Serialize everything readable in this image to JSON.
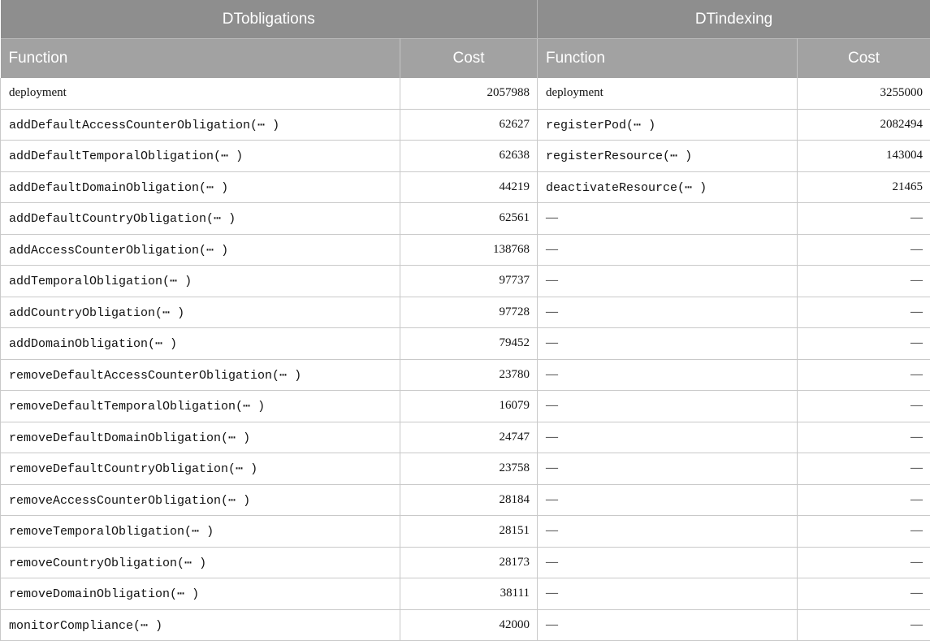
{
  "header": {
    "group_left": "DTobligations",
    "group_right": "DTindexing",
    "col_function_left": "Function",
    "col_cost_left": "Cost",
    "col_function_right": "Function",
    "col_cost_right": "Cost"
  },
  "rows": [
    {
      "f1": "deployment",
      "c1": "2057988",
      "f2": "deployment",
      "c2": "3255000"
    },
    {
      "f1": "addDefaultAccessCounterObligation(⋯ )",
      "c1": "62627",
      "f2": "registerPod(⋯ )",
      "c2": "2082494"
    },
    {
      "f1": "addDefaultTemporalObligation(⋯ )",
      "c1": "62638",
      "f2": "registerResource(⋯ )",
      "c2": "143004"
    },
    {
      "f1": "addDefaultDomainObligation(⋯ )",
      "c1": "44219",
      "f2": "deactivateResource(⋯ )",
      "c2": "21465"
    },
    {
      "f1": "addDefaultCountryObligation(⋯ )",
      "c1": "62561",
      "f2": "—",
      "c2": "—"
    },
    {
      "f1": "addAccessCounterObligation(⋯ )",
      "c1": "138768",
      "f2": "—",
      "c2": "—"
    },
    {
      "f1": "addTemporalObligation(⋯ )",
      "c1": "97737",
      "f2": "—",
      "c2": "—"
    },
    {
      "f1": "addCountryObligation(⋯ )",
      "c1": "97728",
      "f2": "—",
      "c2": "—"
    },
    {
      "f1": "addDomainObligation(⋯ )",
      "c1": "79452",
      "f2": "—",
      "c2": "—"
    },
    {
      "f1": "removeDefaultAccessCounterObligation(⋯ )",
      "c1": "23780",
      "f2": "—",
      "c2": "—"
    },
    {
      "f1": "removeDefaultTemporalObligation(⋯ )",
      "c1": "16079",
      "f2": "—",
      "c2": "—"
    },
    {
      "f1": "removeDefaultDomainObligation(⋯ )",
      "c1": "24747",
      "f2": "—",
      "c2": "—"
    },
    {
      "f1": "removeDefaultCountryObligation(⋯ )",
      "c1": "23758",
      "f2": "—",
      "c2": "—"
    },
    {
      "f1": "removeAccessCounterObligation(⋯ )",
      "c1": "28184",
      "f2": "—",
      "c2": "—"
    },
    {
      "f1": "removeTemporalObligation(⋯ )",
      "c1": "28151",
      "f2": "—",
      "c2": "—"
    },
    {
      "f1": "removeCountryObligation(⋯ )",
      "c1": "28173",
      "f2": "—",
      "c2": "—"
    },
    {
      "f1": "removeDomainObligation(⋯ )",
      "c1": "38111",
      "f2": "—",
      "c2": "—"
    },
    {
      "f1": "monitorCompliance(⋯ )",
      "c1": "42000",
      "f2": "—",
      "c2": "—"
    }
  ]
}
